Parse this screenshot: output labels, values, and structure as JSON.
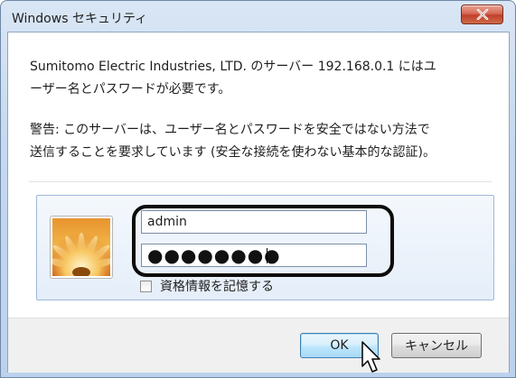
{
  "window": {
    "title": "Windows セキュリティ",
    "close_symbol": "X"
  },
  "message": {
    "line1": "Sumitomo Electric Industries, LTD. のサーバー 192.168.0.1 にはユ",
    "line2": "ーザー名とパスワードが必要です。",
    "warning_line1": "警告: このサーバーは、ユーザー名とパスワードを安全ではない方法で",
    "warning_line2": "送信することを要求しています (安全な接続を使わない基本的な認証)。"
  },
  "credentials": {
    "username_value": "admin",
    "password_masked": "●●●●●●●●",
    "remember_label": "資格情報を記憶する",
    "remember_checked": false
  },
  "buttons": {
    "ok_label": "OK",
    "cancel_label": "キャンセル"
  },
  "colors": {
    "close_button": "#c9533b",
    "ok_border": "#3c7fb1",
    "highlight_ring": "#0b0b0b"
  },
  "icons": {
    "close": "close-icon",
    "avatar": "flower-avatar-icon",
    "cursor": "mouse-pointer-icon"
  }
}
